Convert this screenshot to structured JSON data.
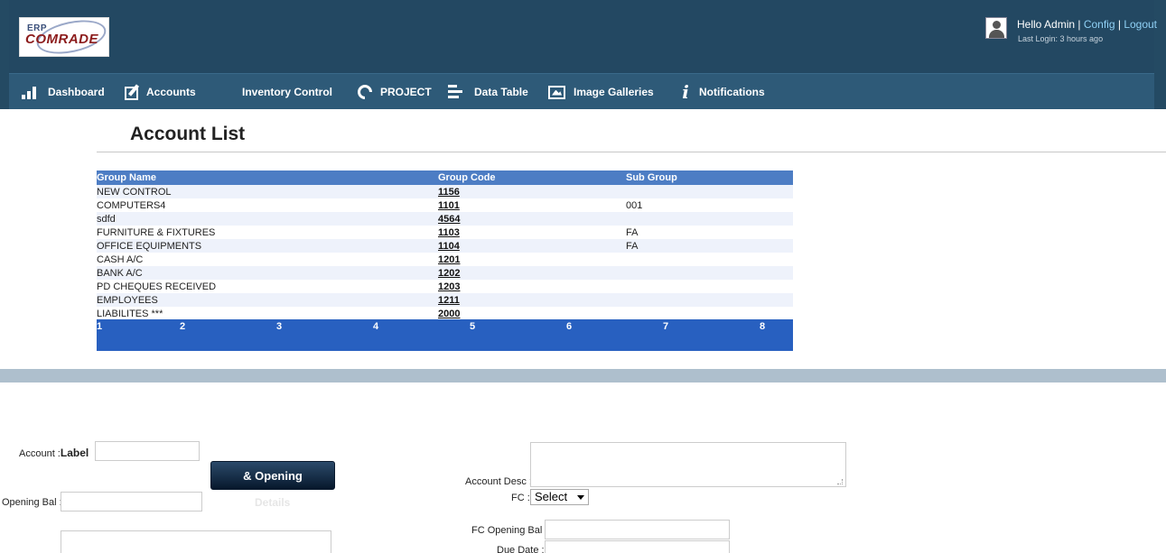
{
  "brand": {
    "erp": "ERP",
    "name": "COMRADE"
  },
  "user": {
    "greeting": "Hello Admin",
    "sep1": " | ",
    "config_link": "Config",
    "sep2": " | ",
    "logout_link": "Logout",
    "last_login": "Last Login: 3 hours ago"
  },
  "nav": {
    "dashboard": "Dashboard",
    "accounts": "Accounts",
    "inventory": "Inventory Control",
    "project": "PROJECT",
    "data_table": "Data Table",
    "image_galleries": "Image Galleries",
    "notifications": "Notifications"
  },
  "page_title": "Account List",
  "table": {
    "headers": {
      "group_name": "Group Name",
      "group_code": "Group Code",
      "sub_group": "Sub Group"
    },
    "rows": [
      {
        "name": "NEW CONTROL",
        "code": "1156",
        "sub": ""
      },
      {
        "name": "COMPUTERS4",
        "code": "1101",
        "sub": "001"
      },
      {
        "name": "sdfd",
        "code": "4564",
        "sub": ""
      },
      {
        "name": "FURNITURE & FIXTURES",
        "code": "1103",
        "sub": "FA"
      },
      {
        "name": "OFFICE EQUIPMENTS",
        "code": "1104",
        "sub": "FA"
      },
      {
        "name": "CASH A/C",
        "code": "1201",
        "sub": ""
      },
      {
        "name": "BANK A/C",
        "code": "1202",
        "sub": ""
      },
      {
        "name": "PD CHEQUES RECEIVED",
        "code": "1203",
        "sub": ""
      },
      {
        "name": "EMPLOYEES",
        "code": "1211",
        "sub": ""
      },
      {
        "name": "LIABILITES ***",
        "code": "2000",
        "sub": ""
      }
    ]
  },
  "pager": [
    "1",
    "2",
    "3",
    "4",
    "5",
    "6",
    "7",
    "8"
  ],
  "form": {
    "account_label": "Account :",
    "label_word": "Label",
    "opening_button": "& Opening",
    "details_text": "Details",
    "opening_bal_label": "Opening Bal :",
    "account_desc_label": "Account Desc :",
    "fc_label": "FC :",
    "fc_select_value": "Select",
    "fc_opening_bal_label": "FC Opening Bal :",
    "due_date_label": "Due Date :"
  },
  "colors": {
    "topbar": "#234862",
    "navbar": "#2e5a78",
    "table_header": "#4d7dc4",
    "pager": "#2860c0",
    "band": "#aebfcd"
  }
}
